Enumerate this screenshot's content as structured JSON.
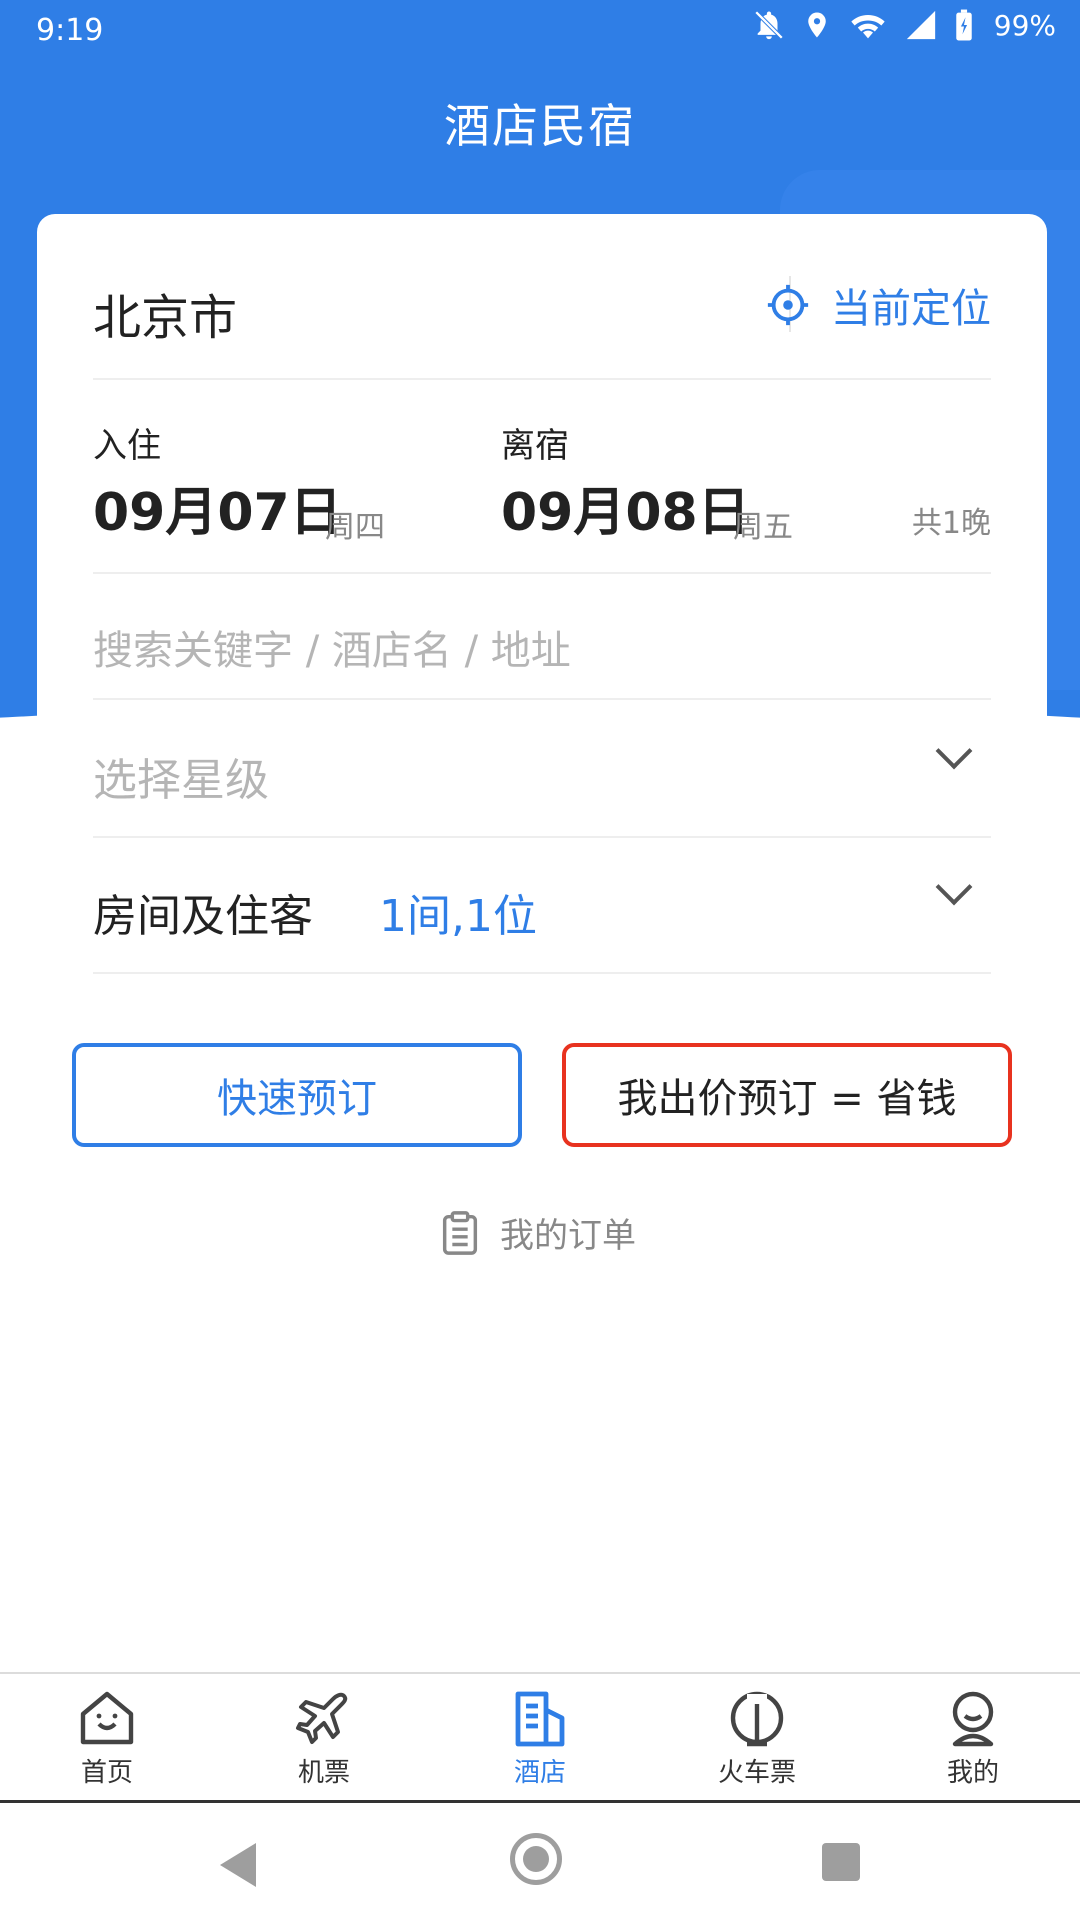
{
  "status": {
    "time": "9:19",
    "battery": "99%"
  },
  "header": {
    "title": "酒店民宿"
  },
  "city": {
    "name": "北京市",
    "locate_label": "当前定位"
  },
  "dates": {
    "checkin_label": "入住",
    "checkin_date": "09月07日",
    "checkin_weekday": "周四",
    "checkout_label": "离宿",
    "checkout_date": "09月08日",
    "checkout_weekday": "周五",
    "nights": "共1晚"
  },
  "search": {
    "placeholder": "搜索关键字 / 酒店名 / 地址"
  },
  "star": {
    "placeholder": "选择星级"
  },
  "rooms": {
    "label": "房间及住客",
    "value": "1间,1位"
  },
  "buttons": {
    "quick": "快速预订",
    "bid": "我出价预订 = 省钱"
  },
  "orders": {
    "label": "我的订单"
  },
  "tabs": [
    {
      "label": "首页",
      "icon": "home-icon"
    },
    {
      "label": "机票",
      "icon": "plane-icon"
    },
    {
      "label": "酒店",
      "icon": "hotel-icon"
    },
    {
      "label": "火车票",
      "icon": "train-icon"
    },
    {
      "label": "我的",
      "icon": "profile-icon"
    }
  ],
  "colors": {
    "primary": "#2f7ee6",
    "accent_red": "#e8321f"
  }
}
